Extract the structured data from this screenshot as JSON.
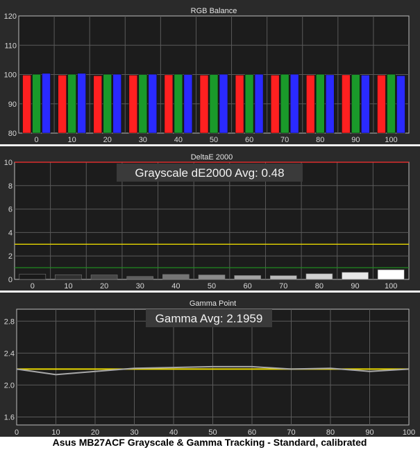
{
  "caption": "Asus MB27ACF Grayscale & Gamma Tracking - Standard, calibrated",
  "chart_data": [
    {
      "type": "bar",
      "title": "RGB Balance",
      "categories": [
        "0",
        "10",
        "20",
        "30",
        "40",
        "50",
        "60",
        "70",
        "80",
        "90",
        "100"
      ],
      "ylim": [
        80,
        120
      ],
      "yticks": [
        80,
        90,
        100,
        110,
        120
      ],
      "grid": true,
      "series": [
        {
          "color": "#ff2020",
          "values": [
            99.8,
            99.8,
            99.6,
            99.8,
            99.9,
            99.8,
            99.8,
            99.8,
            99.8,
            99.9,
            99.8
          ]
        },
        {
          "color": "#1a9a2a",
          "values": [
            100.1,
            100.1,
            100.1,
            100.0,
            100.1,
            100.0,
            100.0,
            100.1,
            100.1,
            100.0,
            100.1
          ]
        },
        {
          "color": "#2a2aff",
          "values": [
            100.4,
            100.4,
            100.1,
            100.1,
            100.0,
            100.1,
            100.1,
            100.1,
            99.9,
            99.8,
            99.6
          ]
        }
      ]
    },
    {
      "type": "bar",
      "title": "DeltaE 2000",
      "annotation": "Grayscale dE2000 Avg: 0.48",
      "categories": [
        "0",
        "10",
        "20",
        "30",
        "40",
        "50",
        "60",
        "70",
        "80",
        "90",
        "100"
      ],
      "ylim": [
        0,
        10
      ],
      "yticks": [
        0,
        2,
        4,
        6,
        8,
        10
      ],
      "grid": true,
      "values": [
        0.45,
        0.4,
        0.38,
        0.25,
        0.42,
        0.38,
        0.33,
        0.32,
        0.48,
        0.6,
        0.82
      ],
      "thresholds": [
        {
          "value": 10,
          "color": "#ff3030"
        },
        {
          "value": 3,
          "color": "#e8d800"
        },
        {
          "value": 1,
          "color": "#1f8a1f"
        }
      ]
    },
    {
      "type": "line",
      "title": "Gamma Point",
      "annotation": "Gamma Avg: 2.1959",
      "x": [
        0,
        10,
        20,
        30,
        40,
        50,
        60,
        70,
        80,
        90,
        100
      ],
      "xticks": [
        0,
        10,
        20,
        30,
        40,
        50,
        60,
        70,
        80,
        90,
        100
      ],
      "ylim": [
        1.5,
        2.95
      ],
      "yticks": [
        1.6,
        2.0,
        2.4,
        2.8
      ],
      "grid": true,
      "series": [
        {
          "color": "#a9a9a9",
          "values": [
            2.2,
            2.13,
            2.17,
            2.21,
            2.22,
            2.23,
            2.23,
            2.2,
            2.21,
            2.17,
            2.2
          ]
        }
      ],
      "reference": {
        "value": 2.2,
        "color": "#e8d800"
      }
    }
  ]
}
